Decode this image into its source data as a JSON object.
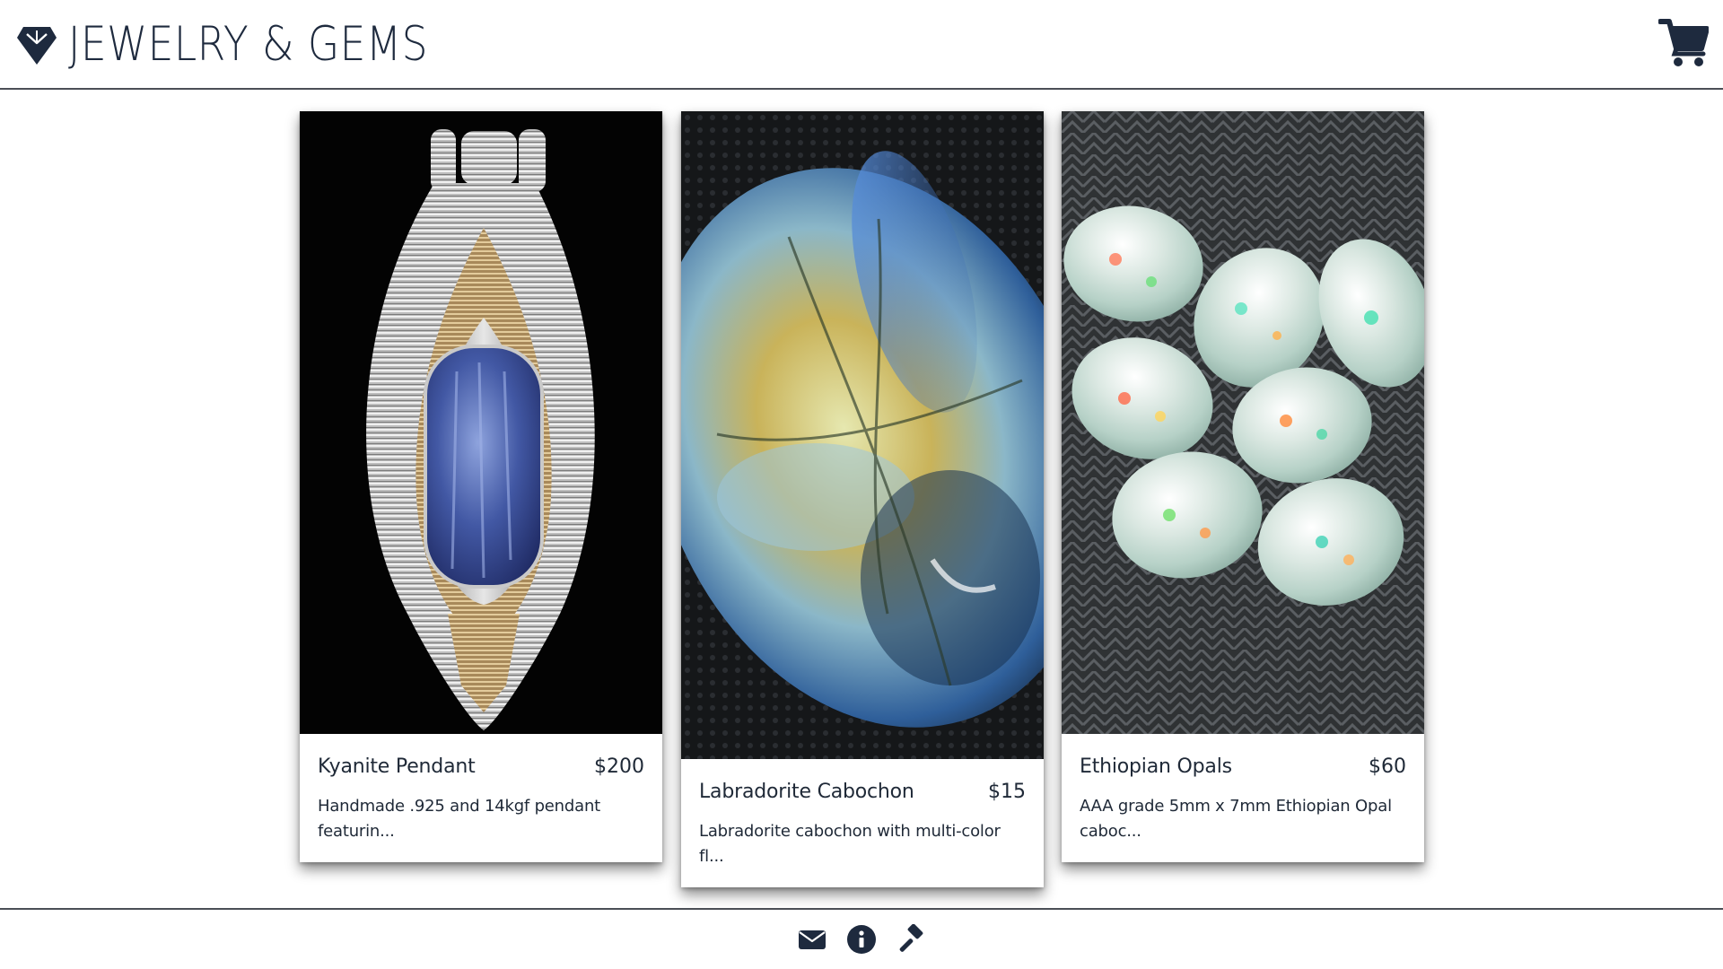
{
  "brand": {
    "title": "JEWELRY & GEMS",
    "logo_icon": "diamond-icon",
    "color": "#1e2a3e"
  },
  "header": {
    "cart_icon": "shopping-cart-icon"
  },
  "products": [
    {
      "name": "Kyanite Pendant",
      "price": "$200",
      "description": "Handmade .925 and 14kgf pendant featurin...",
      "image": "kyanite-pendant-photo"
    },
    {
      "name": "Labradorite Cabochon",
      "price": "$15",
      "description": "Labradorite cabochon with multi-color fl...",
      "image": "labradorite-cabochon-photo"
    },
    {
      "name": "Ethiopian Opals",
      "price": "$60",
      "description": "AAA grade 5mm x 7mm Ethiopian Opal caboc...",
      "image": "ethiopian-opals-photo"
    }
  ],
  "footer": {
    "icons": [
      "envelope-icon",
      "info-icon",
      "gavel-icon"
    ]
  }
}
